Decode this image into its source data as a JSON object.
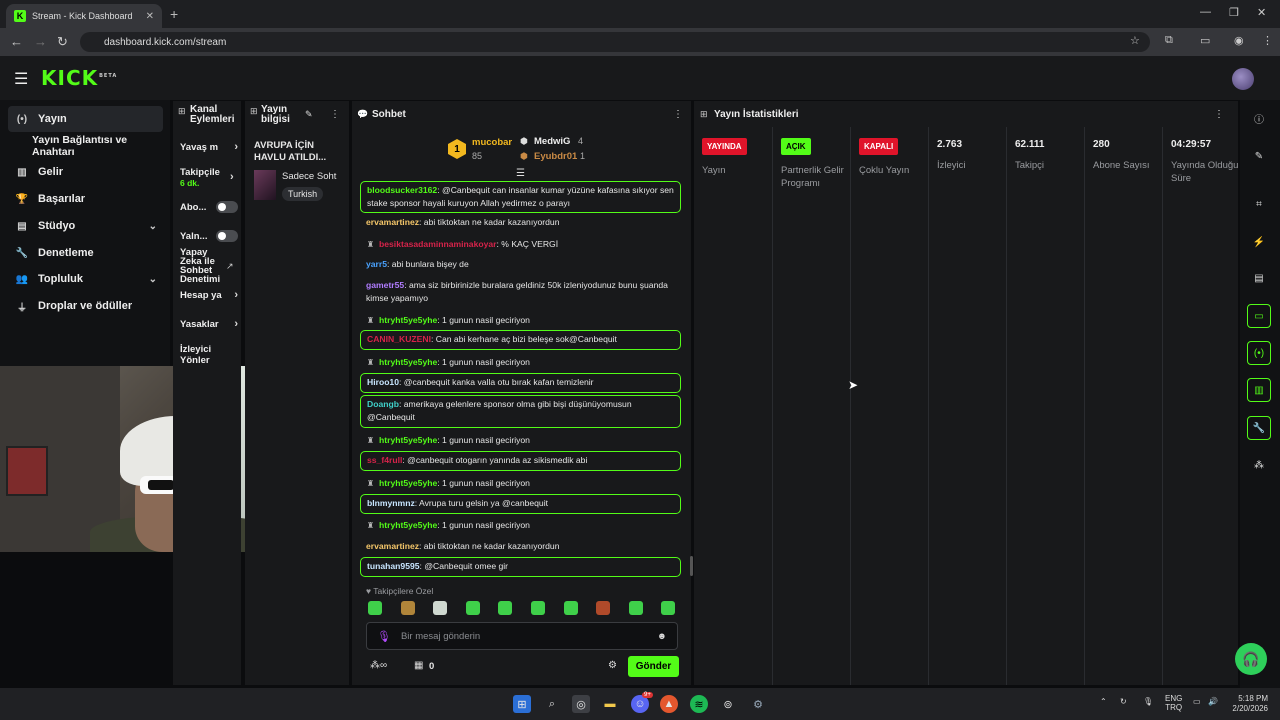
{
  "browser": {
    "tab_title": "Stream - Kick Dashboard",
    "url": "dashboard.kick.com/stream"
  },
  "brand": {
    "logo": "KICK",
    "logo_tag": "BETA"
  },
  "left_nav": {
    "items": [
      {
        "label": "Yayın",
        "icon": "stream-icon"
      },
      {
        "label": "Yayın Bağlantısı ve Anahtarı",
        "icon": ""
      },
      {
        "label": "Gelir",
        "icon": "chart-icon"
      },
      {
        "label": "Başarılar",
        "icon": "trophy-icon"
      },
      {
        "label": "Stüdyo",
        "icon": "studio-icon"
      },
      {
        "label": "Denetleme",
        "icon": "wrench-icon"
      },
      {
        "label": "Topluluk",
        "icon": "people-icon"
      },
      {
        "label": "Droplar ve ödüller",
        "icon": "drops-icon"
      }
    ]
  },
  "channel_panel": {
    "title": "Kanal Eylemleri",
    "rows": {
      "slow": "Yavaş m",
      "followers": "Takipçile",
      "followers_sub": "6 dk.",
      "subs": "Abo...",
      "broadcast": "Yaln...",
      "ai": "Yapay Zeka ile Sohbet Denetimi",
      "account": "Hesap ya",
      "bans": "Yasaklar",
      "viewers": "İzleyici Yönler"
    }
  },
  "info_panel": {
    "title": "Yayın bilgisi",
    "stream_title": "AVRUPA İÇİN HAVLU ATILDI...",
    "category": "Sadece Soht",
    "language": "Turkish"
  },
  "chat": {
    "title": "Sohbet",
    "leaders": {
      "first": {
        "name": "mucobar",
        "count": "85",
        "rank": "1"
      },
      "second": {
        "name": "MedwiG",
        "count": "4"
      },
      "third": {
        "name": "Eyubdr01",
        "count": "1"
      }
    },
    "messages": [
      {
        "user": "bloodsucker3162",
        "text": "@Canbequit can insanlar kumar yüzüne kafasına sıkıyor sen stake sponsor hayali kuruyon Allah yedirmez o parayı",
        "color": "#53fc18"
      },
      {
        "user": "ervamartinez",
        "text": "abi tiktoktan ne kadar kazanıyordun",
        "color": "#f5c76a"
      },
      {
        "user": "besiktasadaminnaminakoyar",
        "text": "% KAÇ VERGİ",
        "color": "#d6234a"
      },
      {
        "user": "yarr5",
        "text": "abi bunlara bişey de",
        "color": "#4aa3ff"
      },
      {
        "user": "gametr55",
        "text": "ama siz birbirinizle buralara geldiniz 50k izleniyodunuz bunu şuanda kimse yapamıyo",
        "color": "#b07cff"
      },
      {
        "user": "htryht5ye5yhe",
        "text": "1 gunun nasil geciriyon",
        "color": "#53fc18"
      },
      {
        "user": "CANIN_KUZENI",
        "text": "Can abi kerhane aç bizi beleşe sok@Canbequit",
        "color": "#d6234a"
      },
      {
        "user": "htryht5ye5yhe",
        "text": "1 gunun nasil geciriyon",
        "color": "#53fc18"
      },
      {
        "user": "Hiroo10",
        "text": "@canbequit kanka valla otu bırak kafan temizlenir",
        "color": "#c8e6ff"
      },
      {
        "user": "Doangb",
        "text": "amerikaya gelenlere sponsor olma gibi bişi düşünüyomusun @Canbequit",
        "color": "#3fd0c9"
      },
      {
        "user": "htryht5ye5yhe",
        "text": "1 gunun nasil geciriyon",
        "color": "#53fc18"
      },
      {
        "user": "ss_f4rull",
        "text": "@canbequit otogarın yanında az sikismedik abi",
        "color": "#d6234a"
      },
      {
        "user": "htryht5ye5yhe",
        "text": "1 gunun nasil geciriyon",
        "color": "#53fc18"
      },
      {
        "user": "blnmynmnz",
        "text": "Avrupa turu gelsin ya @canbequit",
        "color": "#c8e6ff"
      },
      {
        "user": "htryht5ye5yhe",
        "text": "1 gunun nasil geciriyon",
        "color": "#53fc18"
      },
      {
        "user": "ervamartinez",
        "text": "abi tiktoktan ne kadar kazanıyordun",
        "color": "#f5c76a"
      },
      {
        "user": "tunahan9595",
        "text": "@Canbequit omee gir",
        "color": "#c8e6ff"
      }
    ],
    "followers_only": "Takipçilere Özel",
    "input_placeholder": "Bir mesaj gönderin",
    "points": "0",
    "send_label": "Gönder"
  },
  "stats": {
    "title": "Yayın İstatistikleri",
    "columns": [
      {
        "badge": "YAYINDA",
        "label": "Yayın"
      },
      {
        "badge": "AÇIK",
        "label": "Partnerlik Gelir Programı"
      },
      {
        "badge": "KAPALI",
        "label": "Çoklu Yayın"
      },
      {
        "value": "2.763",
        "label": "İzleyici"
      },
      {
        "value": "62.111",
        "label": "Takipçi"
      },
      {
        "value": "280",
        "label": "Abone Sayısı"
      },
      {
        "value": "04:29:57",
        "label": "Yayında Olduğu Süre"
      }
    ]
  },
  "taskbar": {
    "lang": "ENG",
    "lang2": "TRQ",
    "time": "5:18 PM",
    "date": "2/20/2026",
    "badge": "9+"
  },
  "colors": {
    "accent": "#53fc18",
    "live": "#e0142a",
    "panel": "#18191b"
  }
}
